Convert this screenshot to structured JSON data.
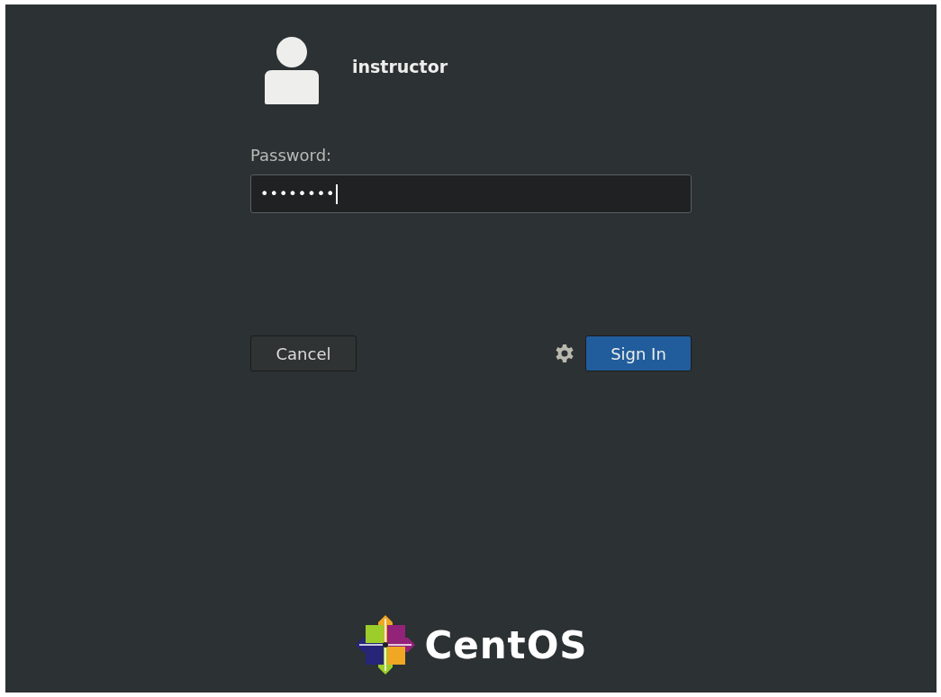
{
  "user": {
    "name": "instructor"
  },
  "password": {
    "label": "Password:",
    "value": "••••••••"
  },
  "buttons": [
    {
      "label": "Cancel",
      "kind": "secondary"
    },
    {
      "label": "Sign In",
      "kind": "primary"
    }
  ],
  "brand": {
    "name": "CentOS"
  }
}
